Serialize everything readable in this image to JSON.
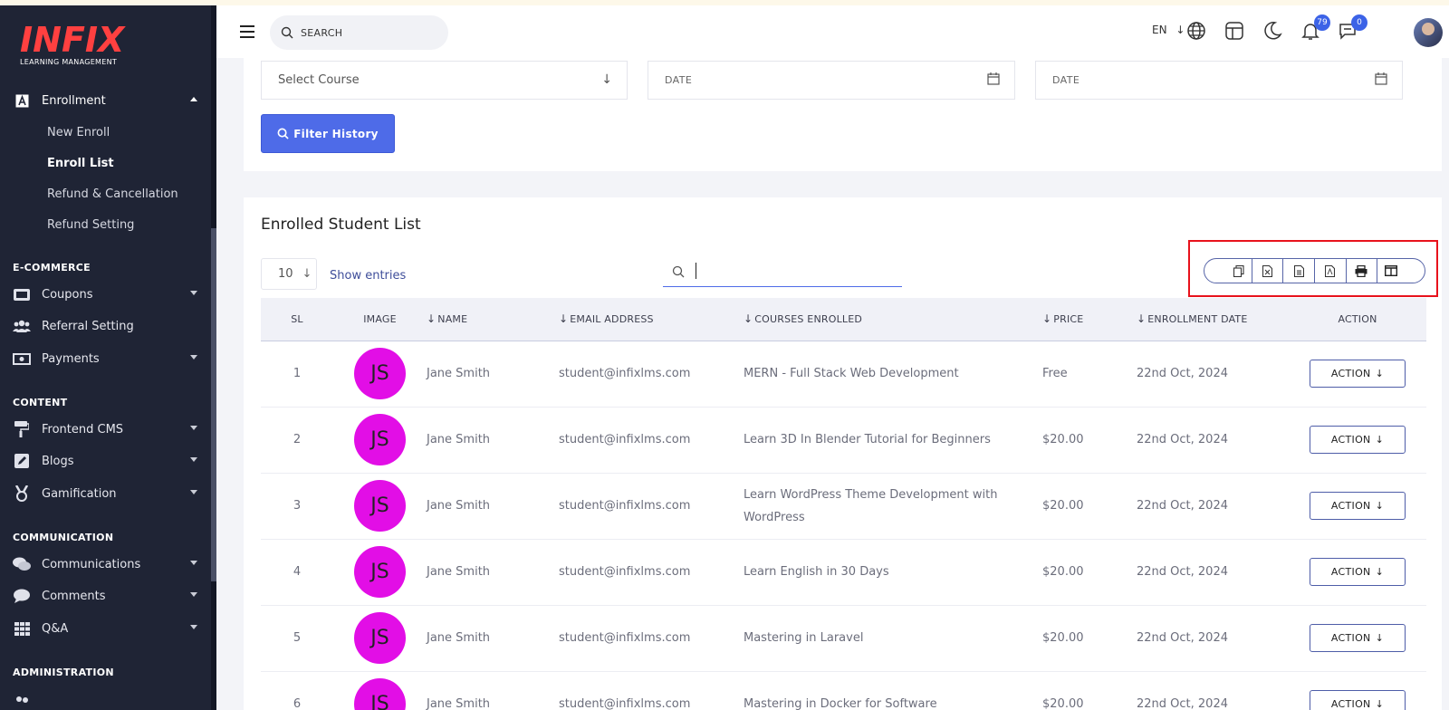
{
  "brand": {
    "logo": "INFIX",
    "tagline": "LEARNING MANAGEMENT",
    "logo_color": "#ff4040"
  },
  "sidebar": {
    "enrollment": "Enrollment",
    "sub_items": [
      "New Enroll",
      "Enroll List",
      "Refund & Cancellation",
      "Refund Setting"
    ],
    "active_sub": "Enroll List",
    "sections": {
      "ecommerce": "E-COMMERCE",
      "content": "CONTENT",
      "communication": "COMMUNICATION",
      "administration": "ADMINISTRATION"
    },
    "items": {
      "coupons": "Coupons",
      "referral": "Referral Setting",
      "payments": "Payments",
      "frontend_cms": "Frontend CMS",
      "blogs": "Blogs",
      "gamification": "Gamification",
      "communications": "Communications",
      "comments": "Comments",
      "qa": "Q&A"
    }
  },
  "header": {
    "search_placeholder": "SEARCH",
    "language": "EN",
    "notification_count": "79",
    "message_count": "0",
    "accent": "#3c63e7"
  },
  "filter": {
    "course_placeholder": "Select Course",
    "date_from_placeholder": "DATE",
    "date_to_placeholder": "DATE",
    "button": "Filter History",
    "button_color": "#4e6be8"
  },
  "list": {
    "title": "Enrolled Student List",
    "page_length": "10",
    "show_entries": "Show entries",
    "columns": [
      "SL",
      "IMAGE",
      "NAME",
      "EMAIL ADDRESS",
      "COURSES ENROLLED",
      "PRICE",
      "ENROLLMENT DATE",
      "ACTION"
    ],
    "action_label": "ACTION",
    "avatar_color": "#e20ee6",
    "rows": [
      {
        "sl": "1",
        "initials": "JS",
        "name": "Jane Smith",
        "email": "student@infixlms.com",
        "course": "MERN - Full Stack Web Development",
        "price": "Free",
        "date": "22nd Oct, 2024"
      },
      {
        "sl": "2",
        "initials": "JS",
        "name": "Jane Smith",
        "email": "student@infixlms.com",
        "course": "Learn 3D In Blender Tutorial for Beginners",
        "price": "$20.00",
        "date": "22nd Oct, 2024"
      },
      {
        "sl": "3",
        "initials": "JS",
        "name": "Jane Smith",
        "email": "student@infixlms.com",
        "course": "Learn WordPress Theme Development with WordPress",
        "price": "$20.00",
        "date": "22nd Oct, 2024"
      },
      {
        "sl": "4",
        "initials": "JS",
        "name": "Jane Smith",
        "email": "student@infixlms.com",
        "course": "Learn English in 30 Days",
        "price": "$20.00",
        "date": "22nd Oct, 2024"
      },
      {
        "sl": "5",
        "initials": "JS",
        "name": "Jane Smith",
        "email": "student@infixlms.com",
        "course": "Mastering in Laravel",
        "price": "$20.00",
        "date": "22nd Oct, 2024"
      },
      {
        "sl": "6",
        "initials": "JS",
        "name": "Jane Smith",
        "email": "student@infixlms.com",
        "course": "Mastering in Docker for Software",
        "price": "$20.00",
        "date": "22nd Oct, 2024"
      }
    ]
  },
  "export_buttons": [
    "copy-icon",
    "excel-icon",
    "csv-icon",
    "pdf-icon",
    "print-icon",
    "columns-icon"
  ]
}
